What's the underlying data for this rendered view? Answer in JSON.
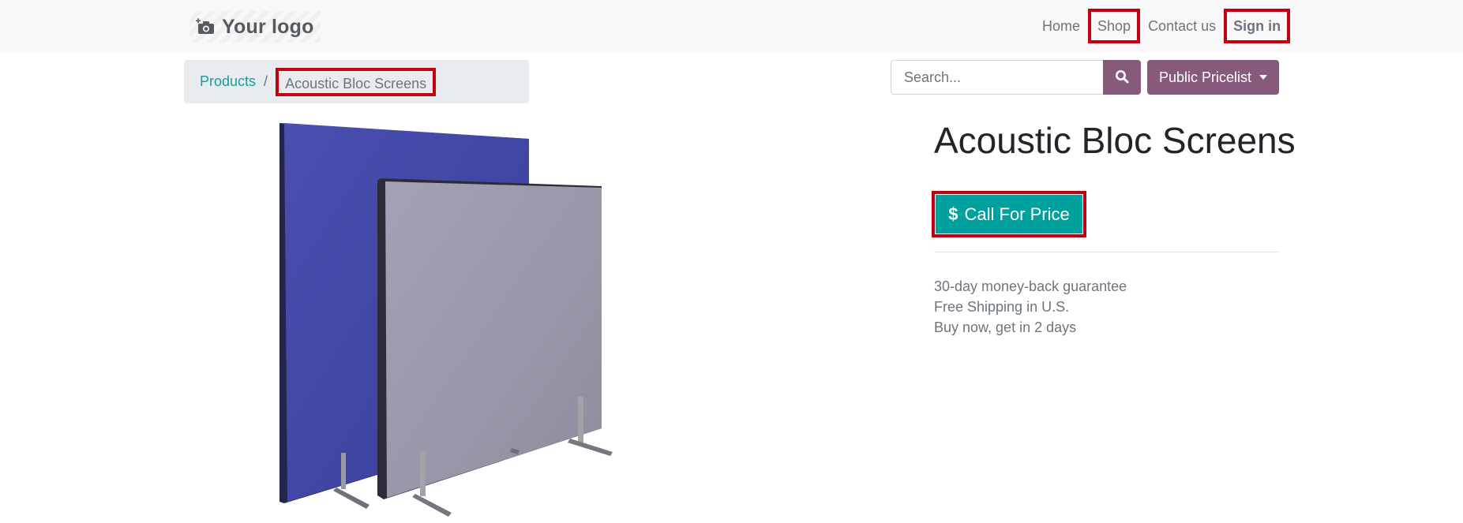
{
  "header": {
    "logo_text": "Your logo",
    "logo_icon": "camera-plus-icon",
    "nav": [
      {
        "label": "Home"
      },
      {
        "label": "Shop"
      },
      {
        "label": "Contact us"
      },
      {
        "label": "Sign in"
      }
    ]
  },
  "breadcrumb": {
    "parent": "Products",
    "separator": "/",
    "current": "Acoustic Bloc Screens"
  },
  "search": {
    "placeholder": "Search...",
    "icon": "search-icon"
  },
  "pricelist": {
    "label": "Public Pricelist"
  },
  "product": {
    "title": "Acoustic Bloc Screens",
    "cta_symbol": "$",
    "cta_label": "Call For Price",
    "perks": [
      "30-day money-back guarantee",
      "Free Shipping in U.S.",
      "Buy now, get in 2 days"
    ]
  },
  "colors": {
    "accent": "#875a7b",
    "cta": "#00a09d",
    "link": "#1a9aa0",
    "highlight": "#c00010"
  }
}
